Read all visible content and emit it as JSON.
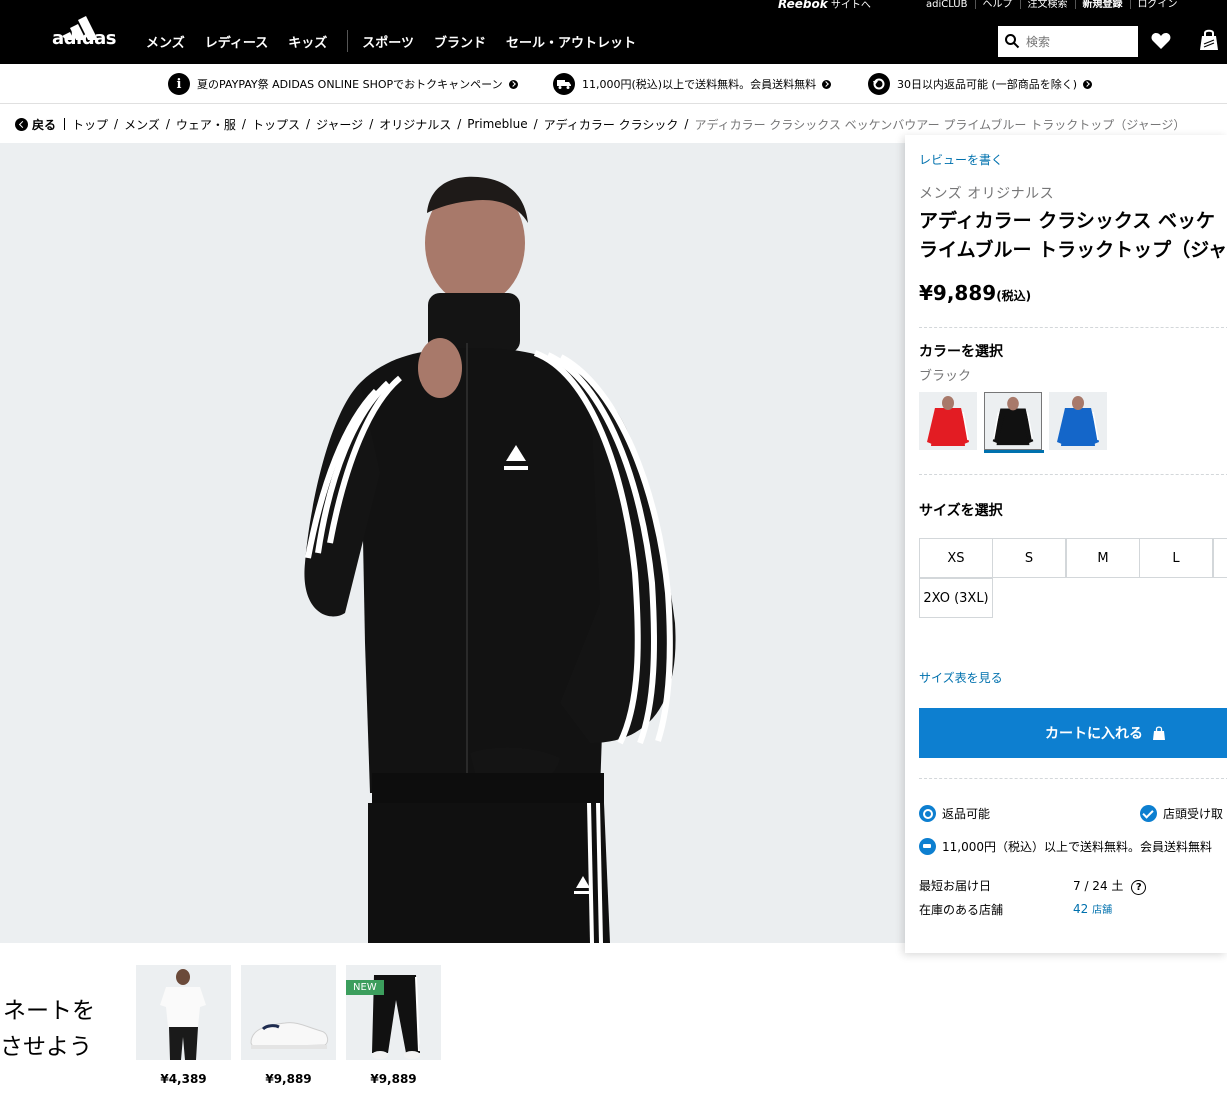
{
  "utility_bar": {
    "reebok_brand": "Reebok",
    "reebok_suffix": "サイトへ",
    "links": [
      "adiCLUB",
      "ヘルプ",
      "注文検索",
      "新規登録",
      "ログイン"
    ]
  },
  "header": {
    "logo_text": "adidas",
    "nav": [
      "メンズ",
      "レディース",
      "キッズ",
      "スポーツ",
      "ブランド",
      "セール・アウトレット"
    ],
    "search_placeholder": "検索"
  },
  "promo": {
    "items": [
      {
        "icon": "i",
        "text": "夏のPAYPAY祭 ADIDAS ONLINE SHOPでおトクキャンペーン"
      },
      {
        "icon": "truck-icon",
        "text": "11,000円(税込)以上で送料無料。会員送料無料"
      },
      {
        "icon": "return-icon",
        "text": "30日以内返品可能 (一部商品を除く)"
      }
    ]
  },
  "breadcrumb": {
    "back": "戻る",
    "items": [
      "トップ",
      "メンズ",
      "ウェア・服",
      "トップス",
      "ジャージ",
      "オリジナルス",
      "Primeblue",
      "アディカラー クラシック"
    ],
    "current": "アディカラー クラシックス ベッケンバウアー プライムブルー トラックトップ（ジャージ）"
  },
  "product": {
    "review_link": "レビューを書く",
    "category": "メンズ オリジナルス",
    "title_line1": "アディカラー クラシックス ベッケ",
    "title_line2": "ライムブルー トラックトップ（ジャ",
    "price": "¥9,889",
    "price_note": "(税込)",
    "color_heading": "カラーを選択",
    "color_selected": "ブラック",
    "colors": [
      {
        "name": "red",
        "hex": "#e31c23"
      },
      {
        "name": "black",
        "hex": "#111111"
      },
      {
        "name": "blue",
        "hex": "#1466c9"
      }
    ],
    "size_heading": "サイズを選択",
    "sizes": [
      "XS",
      "S",
      "M",
      "L",
      "",
      "2XO (3XL)"
    ],
    "size_chart_link": "サイズ表を見る",
    "add_to_cart": "カートに入れる",
    "services": {
      "returns": "返品可能",
      "store_pickup": "店頭受け取",
      "free_shipping": "11,000円（税込）以上で送料無料。会員送料無料"
    },
    "delivery_label": "最短お届け日",
    "delivery_value": "7 / 24",
    "delivery_day": "土",
    "stock_label": "在庫のある店舗",
    "stock_count": "42",
    "stock_unit": "店舗"
  },
  "complete_look": {
    "line1": "ネートを",
    "line2": "させよう",
    "items": [
      {
        "price": "¥4,389",
        "badge": ""
      },
      {
        "price": "¥9,889",
        "badge": ""
      },
      {
        "price": "¥9,889",
        "badge": "NEW"
      }
    ]
  },
  "colors": {
    "accent_blue": "#0d7fd0",
    "link_blue": "#0071ae",
    "header_black": "#000000",
    "new_badge_green": "#3c9e5d"
  }
}
